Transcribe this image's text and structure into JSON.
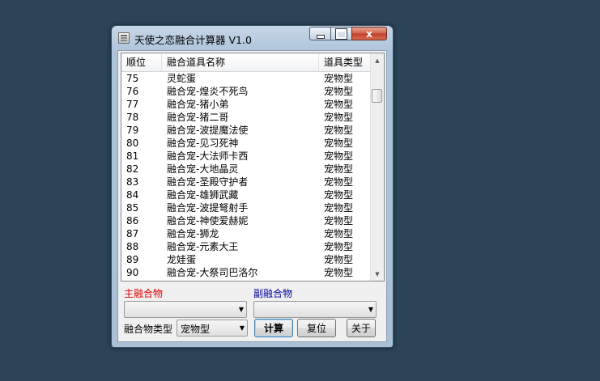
{
  "window": {
    "title": "天使之恋融合计算器 V1.0",
    "close_glyph": "x"
  },
  "list": {
    "columns": [
      "顺位",
      "融合道具名称",
      "道具类型"
    ],
    "rows": [
      [
        "75",
        "灵蛇蛋",
        "宠物型"
      ],
      [
        "76",
        "融合宠-煌炎不死鸟",
        "宠物型"
      ],
      [
        "77",
        "融合宠-猪小弟",
        "宠物型"
      ],
      [
        "78",
        "融合宠-猪二哥",
        "宠物型"
      ],
      [
        "79",
        "融合宠-波提魔法使",
        "宠物型"
      ],
      [
        "80",
        "融合宠-见习死神",
        "宠物型"
      ],
      [
        "81",
        "融合宠-大法师卡西",
        "宠物型"
      ],
      [
        "82",
        "融合宠-大地晶灵",
        "宠物型"
      ],
      [
        "83",
        "融合宠-圣殿守护者",
        "宠物型"
      ],
      [
        "84",
        "融合宠-雄狮武藏",
        "宠物型"
      ],
      [
        "85",
        "融合宠-波提弩射手",
        "宠物型"
      ],
      [
        "86",
        "融合宠-神使爱赫妮",
        "宠物型"
      ],
      [
        "87",
        "融合宠-狮龙",
        "宠物型"
      ],
      [
        "88",
        "融合宠-元素大王",
        "宠物型"
      ],
      [
        "89",
        "龙娃蛋",
        "宠物型"
      ],
      [
        "90",
        "融合宠-大祭司巴洛尔",
        "宠物型"
      ]
    ]
  },
  "form": {
    "main_label": "主融合物",
    "sub_label": "副融合物",
    "main_value": "",
    "sub_value": "",
    "type_label": "融合物类型",
    "type_value": "宠物型",
    "calc_label": "计算",
    "reset_label": "复位",
    "about_label": "关于"
  },
  "colors": {
    "desktop": "#2b4458",
    "main_label": "#e00000",
    "sub_label": "#00009c"
  },
  "icons": {
    "app": "app-icon",
    "minimize": "minimize-icon",
    "maximize": "maximize-icon",
    "close": "close-icon",
    "dropdown": "chevron-down-icon"
  }
}
